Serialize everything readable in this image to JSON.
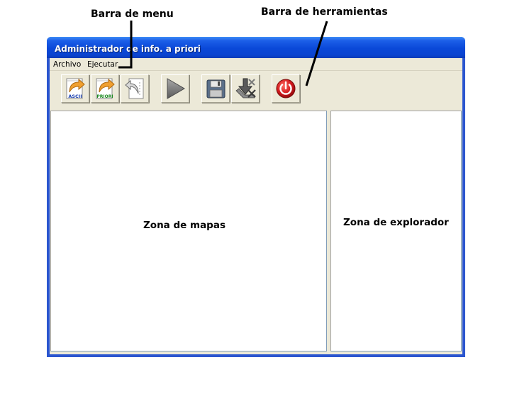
{
  "annotations": {
    "menu_bar": "Barra de menu",
    "toolbar": "Barra de herramientas",
    "map_zone": "Zona de mapas",
    "explorer_zone": "Zona de explorador"
  },
  "window": {
    "title": "Administrador de info. a priori"
  },
  "menu": {
    "items": [
      {
        "label": "Archivo"
      },
      {
        "label": "Ejecutar"
      }
    ]
  },
  "toolbar": {
    "buttons": [
      {
        "icon": "import-ascii-icon",
        "badge": "ASCII"
      },
      {
        "icon": "import-priori-icon",
        "badge": "PRIORI"
      },
      {
        "icon": "undo-arrow-icon"
      },
      {
        "icon": "play-icon"
      },
      {
        "icon": "floppy-save-icon"
      },
      {
        "icon": "download-delete-icon"
      },
      {
        "icon": "power-icon"
      }
    ]
  },
  "colors": {
    "titlebar": "#0a48d8",
    "window_frame": "#2a55cf",
    "client_bg": "#ece9d8",
    "panel_bg": "#ffffff",
    "power_red": "#d0181c",
    "folder_orange": "#f0a030"
  }
}
